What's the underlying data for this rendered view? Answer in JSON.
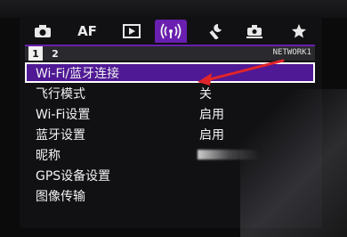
{
  "tabs": [
    {
      "id": "shooting",
      "icon": "camera-icon",
      "label": ""
    },
    {
      "id": "af",
      "icon": "",
      "label": "AF"
    },
    {
      "id": "playback",
      "icon": "play-icon",
      "label": ""
    },
    {
      "id": "wireless",
      "icon": "wireless-icon",
      "label": "",
      "active": true
    },
    {
      "id": "setup",
      "icon": "wrench-icon",
      "label": ""
    },
    {
      "id": "custom",
      "icon": "custom-camera-icon",
      "label": ""
    },
    {
      "id": "my-menu",
      "icon": "star-icon",
      "label": ""
    }
  ],
  "pages": [
    "1",
    "2"
  ],
  "page_name": "NETWORK1",
  "menu": [
    {
      "label": "Wi-Fi/蓝牙连接",
      "value": "",
      "selected": true
    },
    {
      "label": "飞行模式",
      "value": "关"
    },
    {
      "label": "Wi-Fi设置",
      "value": "启用"
    },
    {
      "label": "蓝牙设置",
      "value": "启用"
    },
    {
      "label": "昵称",
      "value": ""
    },
    {
      "label": "GPS设备设置",
      "value": ""
    },
    {
      "label": "图像传输",
      "value": ""
    }
  ],
  "colors": {
    "accent": "#6a1fb0",
    "selection": "#4f1894",
    "arrow": "#e0242b"
  }
}
